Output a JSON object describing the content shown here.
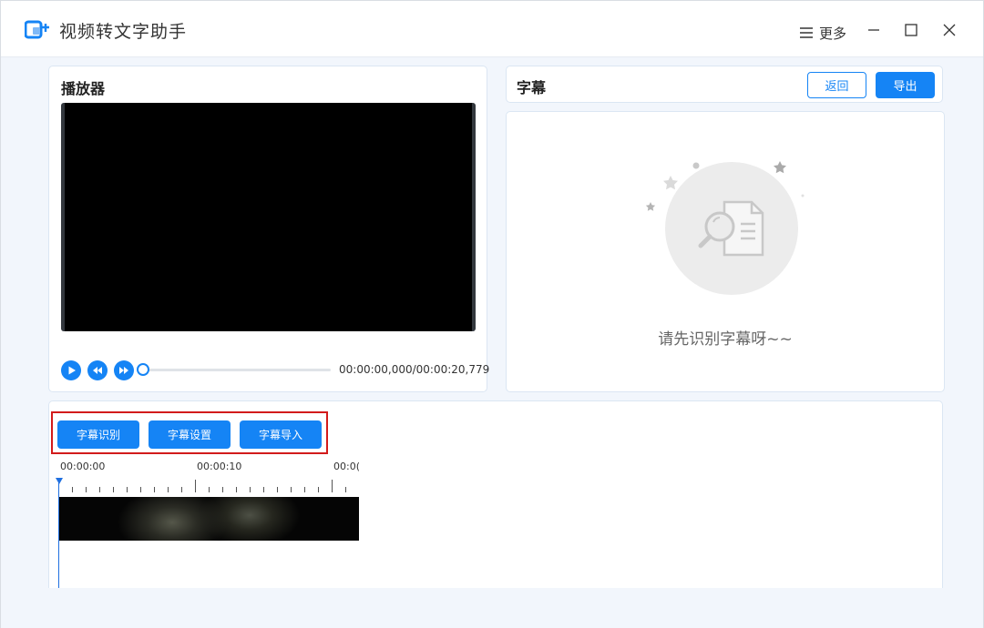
{
  "app": {
    "title": "视频转文字助手",
    "more_label": "更多"
  },
  "player": {
    "title": "播放器",
    "time_text": "00:00:00,000/00:00:20,779",
    "progress": 0
  },
  "subtitle": {
    "title": "字幕",
    "back_label": "返回",
    "export_label": "导出",
    "empty_text": "请先识别字幕呀~~"
  },
  "toolbar": {
    "recognize_label": "字幕识别",
    "settings_label": "字幕设置",
    "import_label": "字幕导入"
  },
  "timeline": {
    "ruler_labels": [
      "00:00:00",
      "00:00:10",
      "00:0("
    ]
  },
  "colors": {
    "accent": "#1584f5",
    "highlight": "#d21b1b"
  },
  "icons": {
    "logo": "app-logo-icon",
    "more": "menu-icon",
    "minimize": "minimize-icon",
    "maximize": "maximize-icon",
    "close": "close-icon",
    "play": "play-icon",
    "rewind": "rewind-icon",
    "forward": "fast-forward-icon",
    "empty": "search-document-icon"
  }
}
